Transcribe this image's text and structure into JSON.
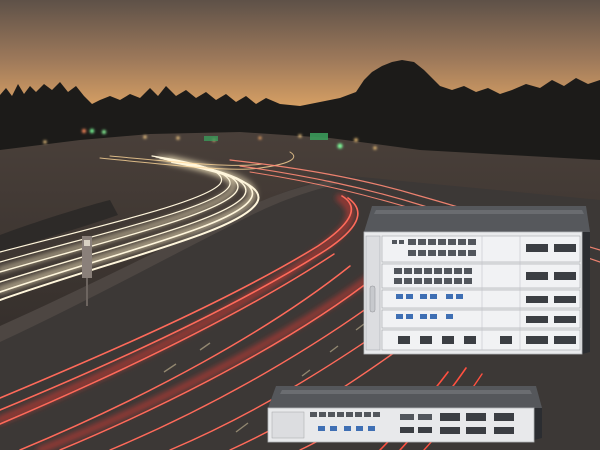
{
  "scene": {
    "description_free": true,
    "colors": {
      "sky_top": "#6e5a49",
      "sky_mid": "#b8895e",
      "sky_glow": "#d9a468",
      "treeline": "#1b1a18",
      "road": "#3a3634",
      "light_warm": "#fff1c8",
      "light_red": "#ff5a4e",
      "chassis_face": "#ecedef",
      "chassis_top": "#5a5c60",
      "chassis_side": "#2b2d31",
      "port_blue": "#3f6fb4"
    },
    "icons": [
      "traffic-light-trail",
      "network-chassis"
    ]
  }
}
